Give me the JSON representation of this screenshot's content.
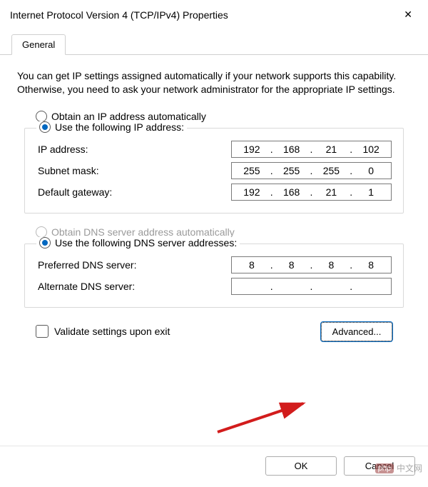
{
  "window": {
    "title": "Internet Protocol Version 4 (TCP/IPv4) Properties"
  },
  "tabs": {
    "general": "General"
  },
  "intro": "You can get IP settings assigned automatically if your network supports this capability. Otherwise, you need to ask your network administrator for the appropriate IP settings.",
  "ip": {
    "auto_label": "Obtain an IP address automatically",
    "manual_label": "Use the following IP address:",
    "address_label": "IP address:",
    "address": {
      "o1": "192",
      "o2": "168",
      "o3": "21",
      "o4": "102"
    },
    "mask_label": "Subnet mask:",
    "mask": {
      "o1": "255",
      "o2": "255",
      "o3": "255",
      "o4": "0"
    },
    "gateway_label": "Default gateway:",
    "gateway": {
      "o1": "192",
      "o2": "168",
      "o3": "21",
      "o4": "1"
    }
  },
  "dns": {
    "auto_label": "Obtain DNS server address automatically",
    "manual_label": "Use the following DNS server addresses:",
    "preferred_label": "Preferred DNS server:",
    "preferred": {
      "o1": "8",
      "o2": "8",
      "o3": "8",
      "o4": "8"
    },
    "alternate_label": "Alternate DNS server:",
    "alternate": {
      "o1": "",
      "o2": "",
      "o3": "",
      "o4": ""
    }
  },
  "validate_label": "Validate settings upon exit",
  "buttons": {
    "advanced": "Advanced...",
    "ok": "OK",
    "cancel": "Cancel"
  },
  "watermark": {
    "badge": "php",
    "text": "中文网"
  }
}
